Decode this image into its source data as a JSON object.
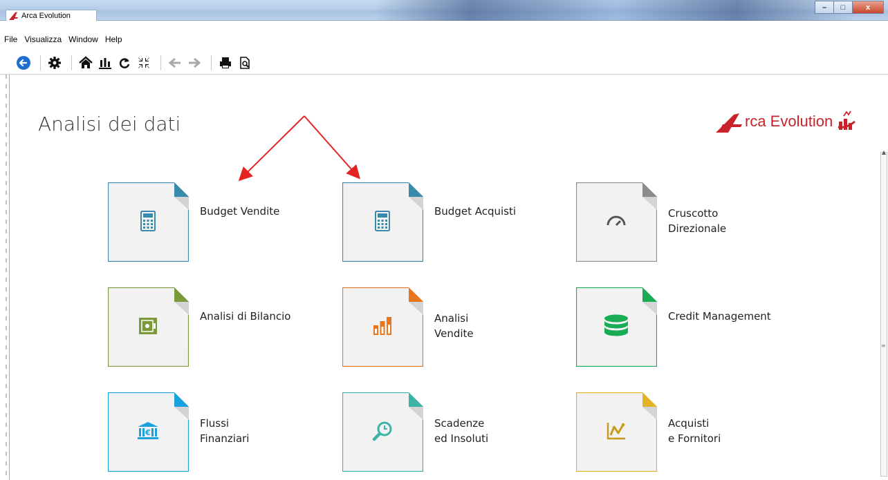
{
  "window": {
    "title": "Arca Evolution",
    "minimize": "–",
    "maximize": "□",
    "close": "x"
  },
  "menu": {
    "items": [
      "File",
      "Visualizza",
      "Window",
      "Help"
    ]
  },
  "toolbar": {
    "icons": [
      "back-icon",
      "gear-icon",
      "home-icon",
      "chart-icon",
      "refresh-icon",
      "collapse-icon",
      "arrow-left-icon",
      "arrow-right-icon",
      "print-icon",
      "print-preview-icon"
    ]
  },
  "page": {
    "title": "Analisi dei dati",
    "brand": "rca Evolution"
  },
  "colors": {
    "budget": "#3a8bab",
    "cruscotto": "#8c8c8c",
    "bilancio": "#7a9a3c",
    "vendite": "#e9751e",
    "credit": "#1aab55",
    "flussi": "#1aa2dd",
    "scadenze": "#3bb3a5",
    "acquisti": "#e2b325",
    "brand_red": "#c8222b"
  },
  "tiles": [
    {
      "label": "Budget Vendite",
      "icon": "calculator-icon"
    },
    {
      "label": "Budget Acquisti",
      "icon": "calculator-icon"
    },
    {
      "label": "Cruscotto\nDirezionale",
      "icon": "gauge-icon"
    },
    {
      "label": "Analisi di Bilancio",
      "icon": "safe-icon"
    },
    {
      "label": "Analisi\nVendite",
      "icon": "bar-chart-icon"
    },
    {
      "label": "Credit Management",
      "icon": "database-icon"
    },
    {
      "label": "Flussi\nFinanziari",
      "icon": "bank-icon"
    },
    {
      "label": "Scadenze\ned Insoluti",
      "icon": "magnifier-clock-icon"
    },
    {
      "label": "Acquisti\ne Fornitori",
      "icon": "line-chart-icon"
    }
  ]
}
